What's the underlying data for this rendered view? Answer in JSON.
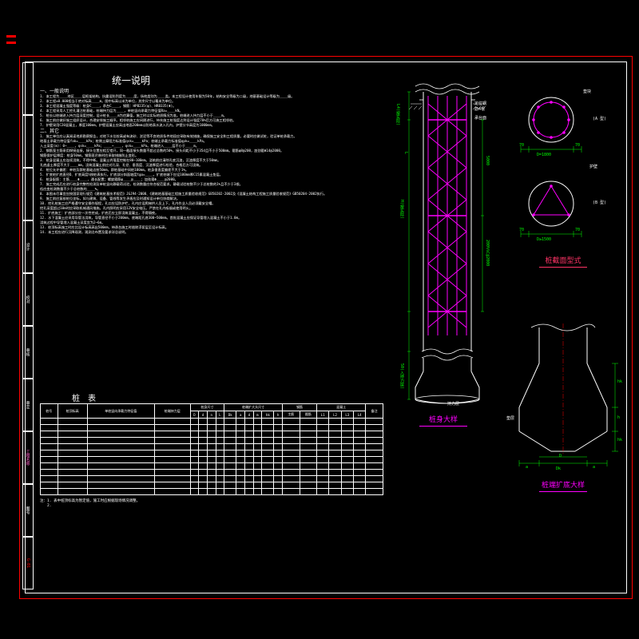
{
  "marks": {
    "top1": "",
    "top2": ""
  },
  "titleblock": {
    "cells": [
      {
        "label": "",
        "cls": ""
      },
      {
        "label": "",
        "cls": ""
      },
      {
        "label": "",
        "cls": "red"
      },
      {
        "label": "设计",
        "cls": ""
      },
      {
        "label": "校对",
        "cls": ""
      },
      {
        "label": "审核",
        "cls": ""
      },
      {
        "label": "审定",
        "cls": ""
      },
      {
        "label": "工程名称",
        "cls": "pink"
      },
      {
        "label": "图号",
        "cls": ""
      },
      {
        "label": "G-01",
        "cls": "red"
      }
    ]
  },
  "sheet": {
    "main_title": "统一说明",
    "section1": "一、一般说明",
    "section2": "二、其它",
    "body_lines": [
      "1. 本工程为____地区____层框架结构，抗震设防烈度为____度，场地类别为____类。本工程设计使用年限为50年，结构安全等级为二级，地基基础设计等级为____级。",
      "2. 本工程±0.000相当于绝对标高____m。图中标高以米为单位，其余尺寸以毫米为单位。",
      "3. 本工程混凝土强度等级：桩身C____，承台C____。钢筋：HPB235(φ)、HRB335(Φ)。",
      "4. 本工程采用人工挖孔灌注桩基础，桩端持力层为____，单桩竖向承载力特征值Ra=____kN。",
      "5. 桩长以桩端进入持力层深度控制，设计桩长____m为估算值，施工时以实际地质情况为准。桩端进入持力层不小于____m。",
      "6. 施工前应做好施工组织设计，合理安排施工顺序。相邻桩施工应间隔进行，待先施工桩强度达到设计强度70%后方可施工相邻桩。",
      "7. 护壁采用C20混凝土，厚度100mm，护壁混凝土应高出地面200mm以防地表水流入孔内。护壁分节高度为1000mm。",
      "1. 施工单位应认真阅读地质勘察报告，对地下水位较高或有流砂、淤泥等不良地质条件地段应采取有效措施，确保施工安全和工程质量。必要时应做试桩，验证单桩承载力。",
      "地基土承载力特征值fak=____kPa；桩侧土摩阻力标准值qsk=____kPa；桩端土承载力标准值qpk=____kPa。",
      "入土深度(m)：0~____，qsk=____kPa；____~____，qsk=____kPa。桩端进入____层不小于____m。",
      "2. 钢筋笼主筋采用焊接连接，接头位置应相互错开，同一截面接头数量不超过总数的50%，接头间距不小于35d且不小于500mm。箍筋φ8@200，加劲箍Φ14@2000。",
      "钢筋保护层厚度：桩身50mm。钢筋笼吊装时应采取措施防止变形。",
      "3. 桩身混凝土应连续浇筑，不得中断。混凝土坍落度控制在80~100mm。浇筑前应清除孔底沉渣，沉渣厚度不大于50mm。",
      "孔底虚土厚度不大于____mm。浇筑混凝土前应对孔深、孔径、垂直度、沉渣厚度进行检验，合格后方可浇筑。",
      "4. 桩位允许偏差：单桩及群桩基础边桩50mm，群桩基础中间桩100mm。桩身垂直度偏差不大于1%。",
      "5. 扩底桩扩底直径D、扩底高度h按桩表执行。扩底部分斜面坡度tgα=____。扩底桩端下应设100mm厚C15素混凝土垫层。",
      "6. 桩身配筋：主筋____Φ____，通长配置；螺旋箍筋φ____@____；加劲箍Φ____@2000。",
      "7. 施工完成后应进行桩身完整性检测及单桩竖向静载荷试验，检测数量应符合规范要求。静载试验桩数不少于总桩数的1%且不少于3根。",
      "低应变检测数量不少于总桩数的____%。",
      "8. 本图未尽事宜应按国家现行规范《建筑桩基技术规范》JGJ94-2008、《建筑地基基础工程施工质量验收规范》GB50202-2002及《混凝土结构工程施工质量验收规范》GB50204-2002执行。",
      "9. 施工前应复核桩位坐标，如与建筑、设备、管线等发生矛盾应及时通知设计单位协商解决。",
      "10. 挖孔桩施工应严格遵守安全操作规程，孔口应设防护栏，孔内应设爬梯供人员上下，孔内作业人员必须戴安全帽。",
      "挖孔深度超过10m时应采取机械通风措施。孔内照明应采用12V安全电压。严禁在孔内吸烟或使用明火。",
      "11. 扩底施工：扩底部分应一次性挖成，扩底后应立即浇筑混凝土，不得隔夜。",
      "12. 水下混凝土应采用导管法浇筑，导管直径不小于200mm，底端距孔底300~500mm。首批混凝土应保证导管埋入混凝土不小于1.0m。",
      "浇筑过程中导管埋入混凝土深度宜为2~6m。",
      "13. 桩顶标高施工时应比设计标高高出500mm，待承台施工时凿除浮浆层至设计标高。",
      "14. 本工程应进行沉降观测，观测点布置及要求详总说明。"
    ],
    "table_title": "桩　表",
    "table_headers_top": [
      "桩号",
      "桩顶标高",
      "单桩竖向承载力特征值",
      "桩端持力层",
      "桩身尺寸",
      "桩端扩大头尺寸",
      "钢筋",
      "混凝土",
      "备注"
    ],
    "table_headers_sub": [
      "",
      "设计/实际",
      "Ra(kN)",
      "",
      "D",
      "d",
      "n",
      "L",
      "H",
      "Dk",
      "a",
      "d",
      "m",
      "hk",
      "h",
      "主筋",
      "箍筋",
      "L1",
      "L2",
      "L3",
      "L4"
    ],
    "table_rows": 12,
    "table_footnote": "注：1. 表中桩顶标高为暂定值，施工时应根据现场情况调整。\n　　2."
  },
  "drawings": {
    "pile_body_title": "桩身大样",
    "section_title": "桩截面型式",
    "bell_title": "桩端扩底大样",
    "label_tie": "持力层",
    "label_casing": "定位钢筋4根",
    "label_ground": "承台面",
    "label_spacer": "垫块",
    "label_casing2": "护壁",
    "label_datum": "垫层",
    "dim_d1": "D=1800",
    "dim_d2": "D≥1500",
    "dim_c": "70",
    "dim_c2": "70",
    "dim_L4L": "L4(按实际)",
    "dim_200": "200%%C@2000",
    "dim_c50": "50(入持力层)",
    "dim_500": "5000",
    "dim_L": "L",
    "dim_L2": "L2",
    "dim_H": "H(按实际)",
    "sec_a": "(A 型)",
    "sec_b": "(B 型)",
    "dim_D": "D",
    "dim_Dk": "Dk",
    "dim_a": "a",
    "dim_h": "h",
    "dim_hk": "hk",
    "dim_hk2": "hk"
  }
}
